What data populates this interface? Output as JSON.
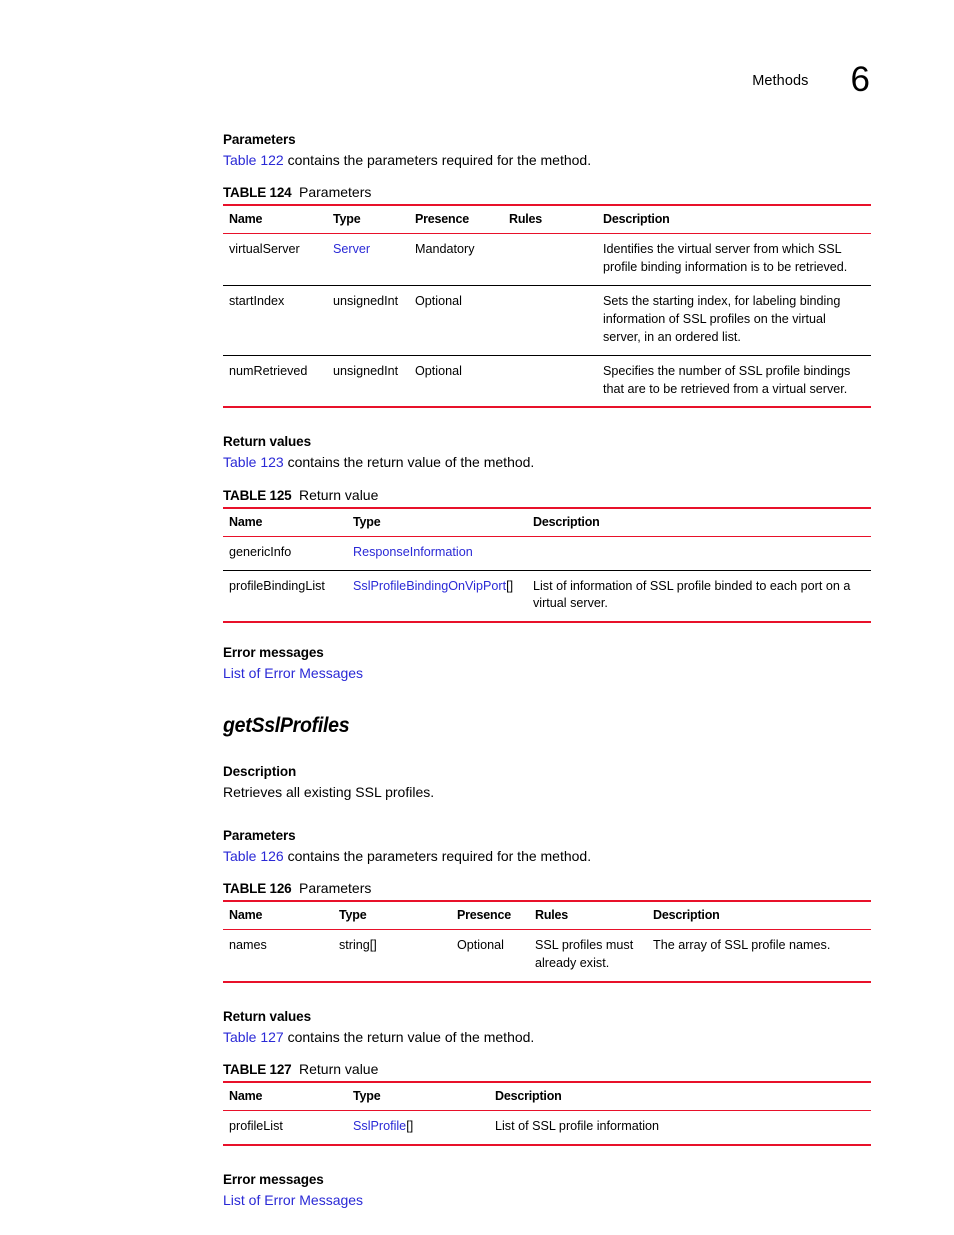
{
  "header": {
    "chapter_word": "Methods",
    "chapter_number": "6"
  },
  "colors": {
    "rule_red": "#e8112a",
    "link_blue": "#2a29d6",
    "text_black": "#000000"
  },
  "sections": {
    "parameters_1": {
      "title": "Parameters",
      "intro_link": "Table 122",
      "intro_rest": " contains the parameters required for the method.",
      "table": {
        "caption_label": "TABLE 124",
        "caption_text": "Parameters",
        "columns": [
          "Name",
          "Type",
          "Presence",
          "Rules",
          "Description"
        ],
        "rows": [
          {
            "name": "virtualServer",
            "type": "Server",
            "type_is_link": true,
            "presence": "Mandatory",
            "rules": "",
            "description": "Identifies the virtual server from which SSL profile binding information is to be retrieved."
          },
          {
            "name": "startIndex",
            "type": "unsignedInt",
            "type_is_link": false,
            "presence": "Optional",
            "rules": "",
            "description": "Sets the starting index, for labeling binding information of SSL profiles on the virtual server, in an ordered list."
          },
          {
            "name": "numRetrieved",
            "type": "unsignedInt",
            "type_is_link": false,
            "presence": "Optional",
            "rules": "",
            "description": "Specifies the number of SSL profile bindings that are to be retrieved from a virtual server."
          }
        ]
      }
    },
    "return_values_1": {
      "title": "Return values",
      "intro_link": "Table 123",
      "intro_rest": " contains the return value of the method.",
      "table": {
        "caption_label": "TABLE 125",
        "caption_text": "Return value",
        "columns": [
          "Name",
          "Type",
          "Description"
        ],
        "rows": [
          {
            "name": "genericInfo",
            "type_link": "ResponseInformation",
            "type_suffix": "",
            "description": ""
          },
          {
            "name": "profileBindingList",
            "type_link": "SslProfileBindingOnVipPort",
            "type_suffix": "[]",
            "description": "List of information of SSL profile binded to each port on a virtual server."
          }
        ]
      }
    },
    "error_messages_1": {
      "title": "Error messages",
      "link": "List of Error Messages"
    },
    "method": {
      "name": "getSslProfiles"
    },
    "description": {
      "title": "Description",
      "text": "Retrieves all existing SSL profiles."
    },
    "parameters_2": {
      "title": "Parameters",
      "intro_link": "Table 126",
      "intro_rest": " contains the parameters required for the method.",
      "table": {
        "caption_label": "TABLE 126",
        "caption_text": "Parameters",
        "columns": [
          "Name",
          "Type",
          "Presence",
          "Rules",
          "Description"
        ],
        "rows": [
          {
            "name": "names",
            "type": "string[]",
            "type_is_link": false,
            "presence": "Optional",
            "rules": "SSL profiles must already exist.",
            "description": "The array of SSL profile names."
          }
        ]
      }
    },
    "return_values_2": {
      "title": "Return values",
      "intro_link": "Table 127",
      "intro_rest": " contains the return value of the method.",
      "table": {
        "caption_label": "TABLE 127",
        "caption_text": "Return value",
        "columns": [
          "Name",
          "Type",
          "Description"
        ],
        "rows": [
          {
            "name": "profileList",
            "type_link": "SslProfile",
            "type_suffix": "[]",
            "description": "List of SSL profile information"
          }
        ]
      }
    },
    "error_messages_2": {
      "title": "Error messages",
      "link": "List of Error Messages"
    }
  }
}
